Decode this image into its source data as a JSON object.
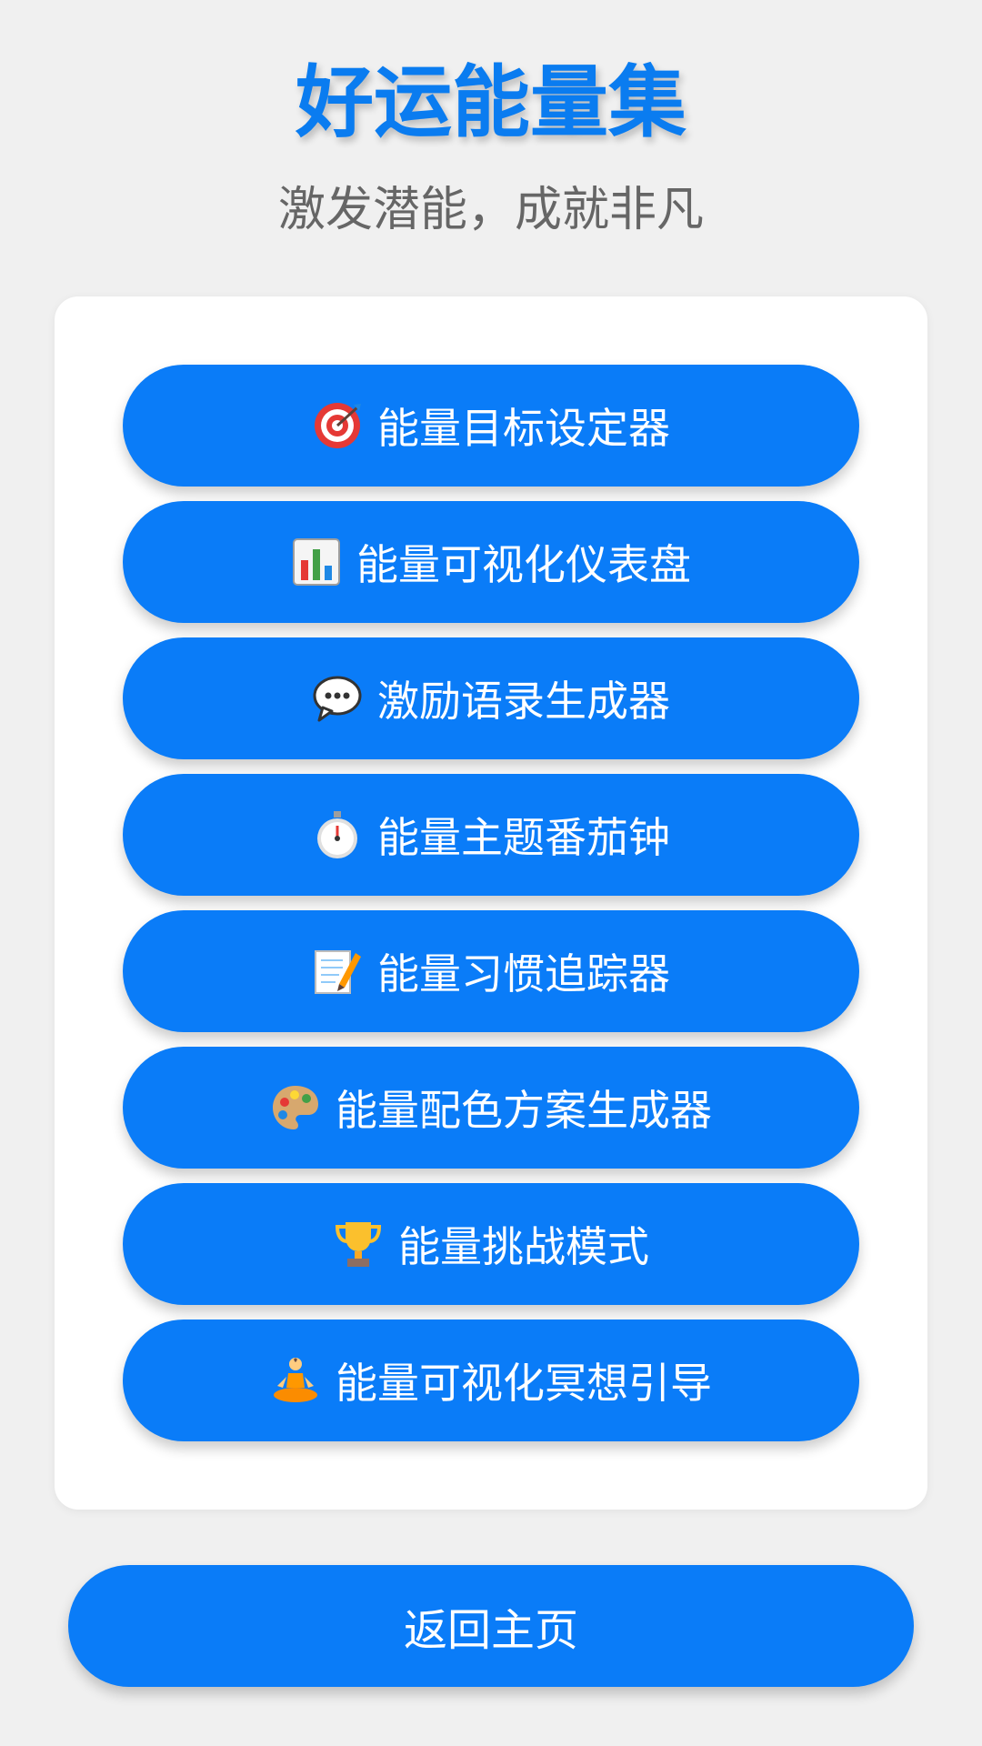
{
  "header": {
    "title": "好运能量集",
    "subtitle": "激发潜能，成就非凡"
  },
  "menu": {
    "items": [
      {
        "label": "能量目标设定器",
        "icon": "target-icon"
      },
      {
        "label": "能量可视化仪表盘",
        "icon": "bar-chart-icon"
      },
      {
        "label": "激励语录生成器",
        "icon": "speech-bubble-icon"
      },
      {
        "label": "能量主题番茄钟",
        "icon": "stopwatch-icon"
      },
      {
        "label": "能量习惯追踪器",
        "icon": "memo-icon"
      },
      {
        "label": "能量配色方案生成器",
        "icon": "palette-icon"
      },
      {
        "label": "能量挑战模式",
        "icon": "trophy-icon"
      },
      {
        "label": "能量可视化冥想引导",
        "icon": "meditation-icon"
      }
    ]
  },
  "footer": {
    "home_label": "返回主页"
  },
  "colors": {
    "accent": "#0a7cf8",
    "title": "#0a7cf0",
    "background": "#f0f0f0",
    "card": "#ffffff",
    "subtitle": "#666666"
  }
}
